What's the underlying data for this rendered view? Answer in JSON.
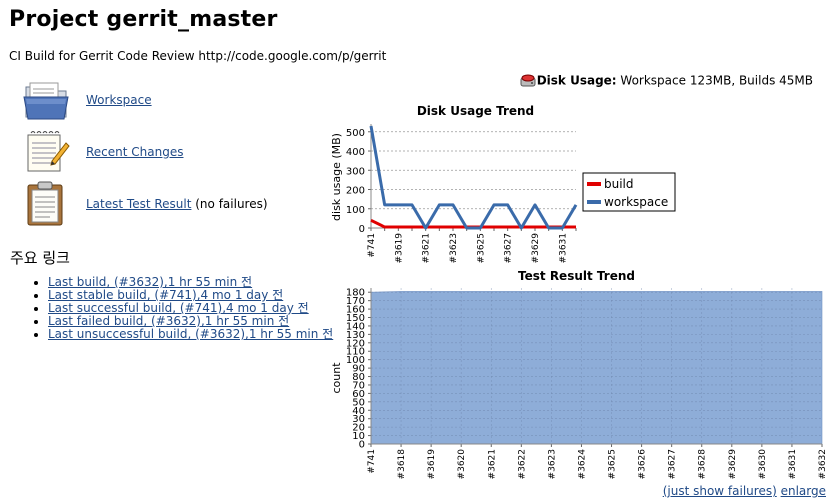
{
  "page": {
    "title": "Project gerrit_master",
    "description": "CI Build for Gerrit Code Review http://code.google.com/p/gerrit"
  },
  "disk_usage": {
    "label": "Disk Usage:",
    "value": "Workspace 123MB, Builds 45MB"
  },
  "tasks": [
    {
      "label": "Workspace",
      "icon": "folder-icon"
    },
    {
      "label": "Recent Changes",
      "icon": "notepad-icon"
    },
    {
      "label": "Latest Test Result",
      "suffix": "(no failures)",
      "icon": "clipboard-icon"
    }
  ],
  "permalinks": {
    "heading": "주요 링크",
    "items": [
      "Last build, (#3632),1 hr 55 min 전",
      "Last stable build, (#741),4 mo 1 day 전",
      "Last successful build, (#741),4 mo 1 day 전",
      "Last failed build, (#3632),1 hr 55 min 전",
      "Last unsuccessful build, (#3632),1 hr 55 min 전"
    ]
  },
  "test_links": {
    "just_failures": "(just show failures)",
    "enlarge": "enlarge"
  },
  "chart_data": [
    {
      "type": "line",
      "title": "Disk Usage Trend",
      "ylabel": "disk usage (MB)",
      "ylim": [
        0,
        530
      ],
      "yticks": [
        0,
        100,
        200,
        300,
        400,
        500
      ],
      "categories": [
        "#741",
        "#3618",
        "#3619",
        "#3620",
        "#3621",
        "#3622",
        "#3623",
        "#3624",
        "#3625",
        "#3626",
        "#3627",
        "#3628",
        "#3629",
        "#3630",
        "#3631",
        "#3632"
      ],
      "xtick_labels": [
        "#741",
        "#3619",
        "#3621",
        "#3623",
        "#3625",
        "#3627",
        "#3629",
        "#3631"
      ],
      "legend": "right",
      "grid": true,
      "series": [
        {
          "name": "build",
          "color": "#E00000",
          "values": [
            40,
            5,
            5,
            5,
            5,
            5,
            5,
            5,
            5,
            5,
            5,
            5,
            5,
            5,
            5,
            5
          ]
        },
        {
          "name": "workspace",
          "color": "#3A6BAA",
          "values": [
            530,
            120,
            120,
            120,
            0,
            120,
            120,
            0,
            0,
            120,
            120,
            0,
            120,
            0,
            0,
            120
          ]
        }
      ]
    },
    {
      "type": "area",
      "title": "Test Result Trend",
      "ylabel": "count",
      "ylim": [
        0,
        185
      ],
      "yticks": [
        0,
        10,
        20,
        30,
        40,
        50,
        60,
        70,
        80,
        90,
        100,
        110,
        120,
        130,
        140,
        150,
        160,
        170,
        180
      ],
      "categories": [
        "#741",
        "#3618",
        "#3619",
        "#3620",
        "#3621",
        "#3622",
        "#3623",
        "#3624",
        "#3625",
        "#3626",
        "#3627",
        "#3628",
        "#3629",
        "#3630",
        "#3631",
        "#3632"
      ],
      "grid": true,
      "series": [
        {
          "name": "",
          "color": "#8EADD8",
          "values": [
            180,
            181,
            181,
            181,
            181,
            181,
            181,
            181,
            181,
            181,
            181,
            181,
            181,
            181,
            181,
            181
          ]
        }
      ]
    }
  ]
}
